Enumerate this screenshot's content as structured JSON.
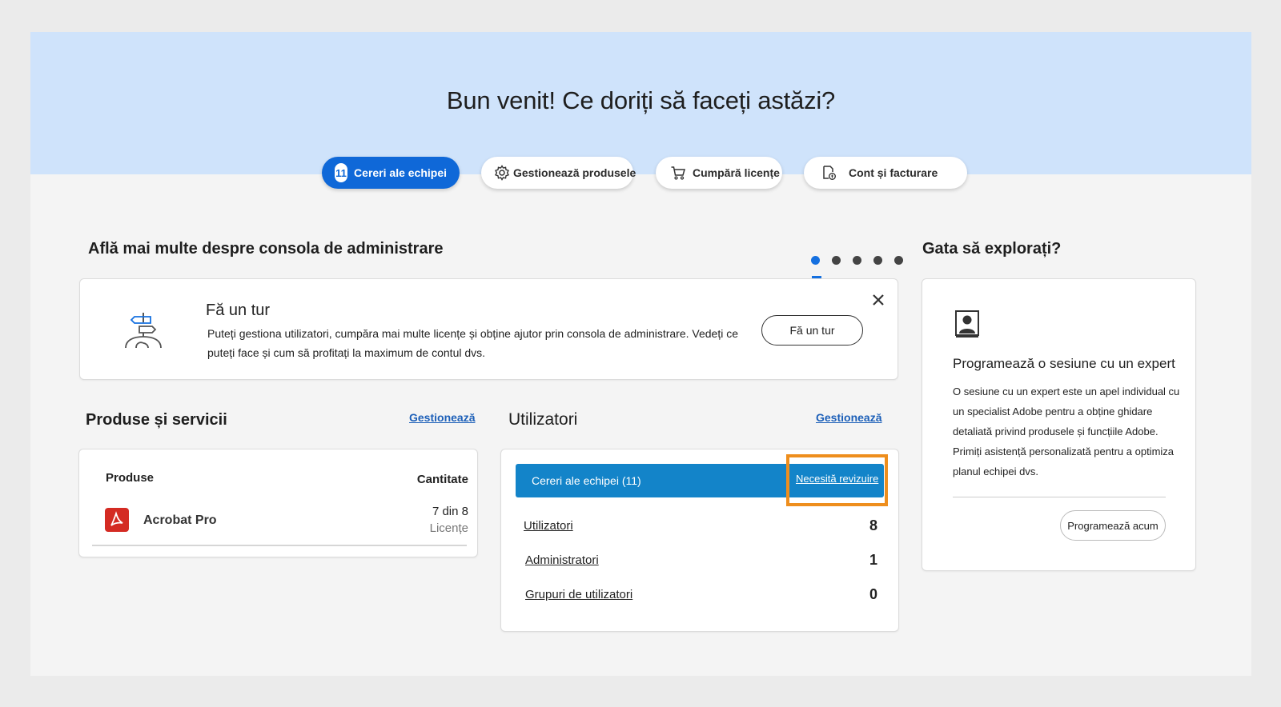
{
  "hero": {
    "title": "Bun venit! Ce doriți să faceți astăzi?",
    "tabs": [
      {
        "label": "Cereri ale echipei",
        "count": "11",
        "icon": "count-badge"
      },
      {
        "label": "Gestionează produsele",
        "icon": "gear-icon"
      },
      {
        "label": "Cumpără licențe",
        "icon": "cart-icon"
      },
      {
        "label": "Cont și facturare",
        "icon": "billing-document-icon"
      }
    ]
  },
  "learn": {
    "heading": "Află mai multe despre consola de administrare",
    "carousel_total": 5,
    "carousel_active": 1,
    "tour": {
      "title": "Fă un tur",
      "text": "Puteți gestiona utilizatori, cumpăra mai multe licențe și obține ajutor prin consola de administrare. Vedeți ce puteți face și cum să profitați la maximum de contul dvs.",
      "button": "Fă un tur",
      "icon": "signpost-icon"
    }
  },
  "products": {
    "heading": "Produse și servicii",
    "manage_link": "Gestionează",
    "col_product": "Produse",
    "col_quantity": "Cantitate",
    "items": [
      {
        "name": "Acrobat Pro",
        "quantity": "7 din 8",
        "unit": "Licențe",
        "icon": "acrobat-icon"
      }
    ]
  },
  "users": {
    "heading": "Utilizatori",
    "manage_link": "Gestionează",
    "requests_label": "Cereri ale echipei (11)",
    "review_link": "Necesită revizuire",
    "rows": [
      {
        "label": "Utilizatori",
        "value": "8"
      },
      {
        "label": "Administratori",
        "value": "1"
      },
      {
        "label": "Grupuri de utilizatori",
        "value": "0"
      }
    ]
  },
  "explore": {
    "heading": "Gata să explorați?",
    "card_title": "Programează o sesiune cu un expert",
    "card_text": "O sesiune cu un expert este un apel individual cu un specialist Adobe pentru a obține ghidare detaliată privind produsele și funcțiile Adobe. Primiți asistență personalizată pentru a optimiza planul echipei dvs.",
    "button": "Programează acum",
    "icon": "expert-portrait-icon"
  },
  "colors": {
    "hero_bg": "#cfe3fb",
    "primary": "#0f68d8",
    "bar": "#1384c9",
    "highlight": "#ee8e1d",
    "link": "#1c5fb8"
  }
}
